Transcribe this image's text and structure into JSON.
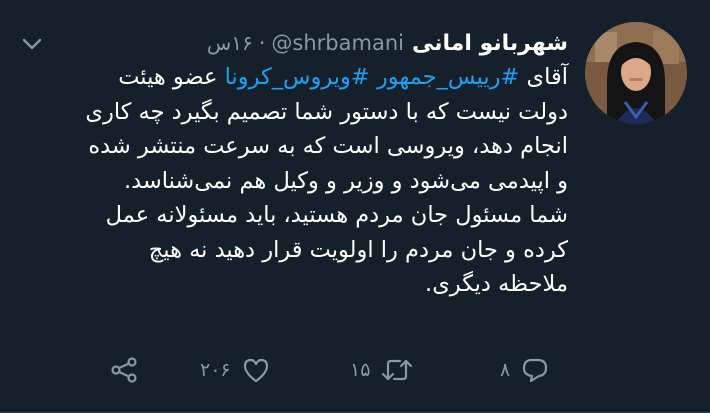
{
  "tweet": {
    "display_name": "شهربانو امانی",
    "handle": "@shrbamani",
    "separator": "·",
    "time": "۱۶س",
    "avatar_icon": "user-avatar-photo",
    "more_icon": "chevron-down-icon",
    "body": {
      "line1_prefix": "آقای ",
      "hashtag1": "#رییس_جمهور",
      "line1_space": " ",
      "hashtag2": "#ویروس_کرونا",
      "line1_suffix": " عضو هیئت",
      "line2": "دولت نیست که با دستور شما تصمیم بگیرد چه کاری",
      "line3": "انجام دهد، ویروسی است که به سرعت منتشر شده",
      "line4": "و اپیدمی می‌شود و وزیر و وکیل هم نمی‌شناسد.",
      "line5": " شما مسئول جان مردم هستید، باید مسئولانه عمل",
      "line6": "کرده و جان مردم را اولویت قرار دهید نه هیچ",
      "line7": "ملاحظه دیگری."
    },
    "actions": {
      "reply_count": "۸",
      "retweet_count": "۱۵",
      "like_count": "۲۰۶",
      "reply_icon": "reply-icon",
      "retweet_icon": "retweet-icon",
      "like_icon": "heart-icon",
      "share_icon": "share-icon"
    }
  },
  "colors": {
    "background": "#15202b",
    "text": "#ffffff",
    "secondary": "#8899a6",
    "link": "#1da1f2",
    "divider": "#38444d"
  }
}
